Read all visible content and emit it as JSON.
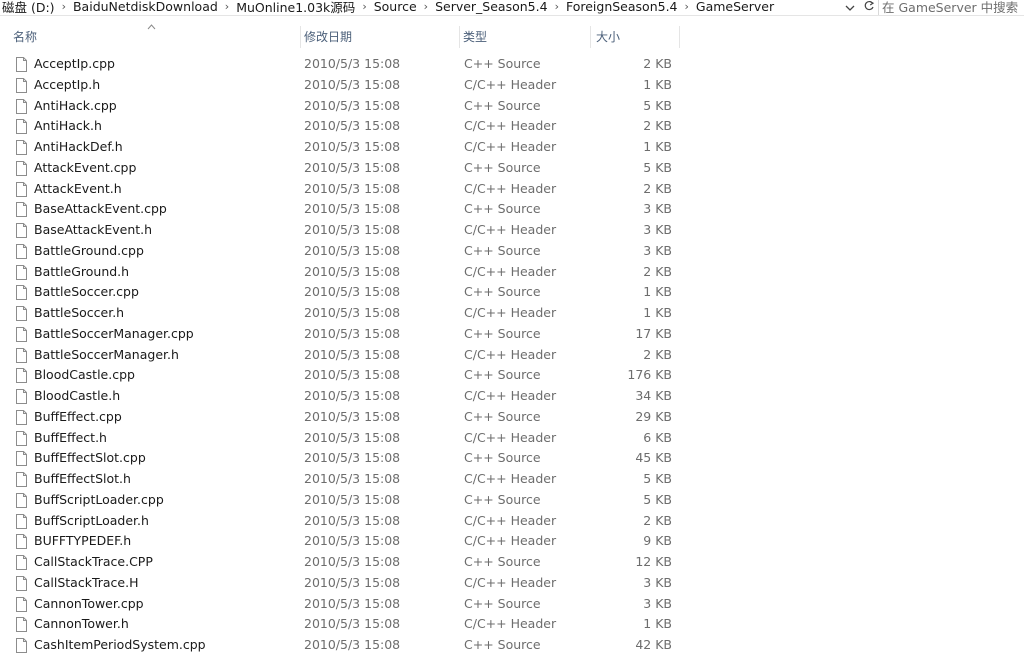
{
  "address": {
    "crumbs": [
      "磁盘 (D:)",
      "BaiduNetdiskDownload",
      "MuOnline1.03k源码",
      "Source",
      "Server_Season5.4",
      "ForeignSeason5.4",
      "GameServer"
    ],
    "search_placeholder": "在 GameServer 中搜索"
  },
  "columns": {
    "name": "名称",
    "date": "修改日期",
    "type": "类型",
    "size": "大小"
  },
  "files": [
    {
      "name": "AcceptIp.cpp",
      "date": "2010/5/3 15:08",
      "type": "C++ Source",
      "size": "2 KB"
    },
    {
      "name": "AcceptIp.h",
      "date": "2010/5/3 15:08",
      "type": "C/C++ Header",
      "size": "1 KB"
    },
    {
      "name": "AntiHack.cpp",
      "date": "2010/5/3 15:08",
      "type": "C++ Source",
      "size": "5 KB"
    },
    {
      "name": "AntiHack.h",
      "date": "2010/5/3 15:08",
      "type": "C/C++ Header",
      "size": "2 KB"
    },
    {
      "name": "AntiHackDef.h",
      "date": "2010/5/3 15:08",
      "type": "C/C++ Header",
      "size": "1 KB"
    },
    {
      "name": "AttackEvent.cpp",
      "date": "2010/5/3 15:08",
      "type": "C++ Source",
      "size": "5 KB"
    },
    {
      "name": "AttackEvent.h",
      "date": "2010/5/3 15:08",
      "type": "C/C++ Header",
      "size": "2 KB"
    },
    {
      "name": "BaseAttackEvent.cpp",
      "date": "2010/5/3 15:08",
      "type": "C++ Source",
      "size": "3 KB"
    },
    {
      "name": "BaseAttackEvent.h",
      "date": "2010/5/3 15:08",
      "type": "C/C++ Header",
      "size": "3 KB"
    },
    {
      "name": "BattleGround.cpp",
      "date": "2010/5/3 15:08",
      "type": "C++ Source",
      "size": "3 KB"
    },
    {
      "name": "BattleGround.h",
      "date": "2010/5/3 15:08",
      "type": "C/C++ Header",
      "size": "2 KB"
    },
    {
      "name": "BattleSoccer.cpp",
      "date": "2010/5/3 15:08",
      "type": "C++ Source",
      "size": "1 KB"
    },
    {
      "name": "BattleSoccer.h",
      "date": "2010/5/3 15:08",
      "type": "C/C++ Header",
      "size": "1 KB"
    },
    {
      "name": "BattleSoccerManager.cpp",
      "date": "2010/5/3 15:08",
      "type": "C++ Source",
      "size": "17 KB"
    },
    {
      "name": "BattleSoccerManager.h",
      "date": "2010/5/3 15:08",
      "type": "C/C++ Header",
      "size": "2 KB"
    },
    {
      "name": "BloodCastle.cpp",
      "date": "2010/5/3 15:08",
      "type": "C++ Source",
      "size": "176 KB"
    },
    {
      "name": "BloodCastle.h",
      "date": "2010/5/3 15:08",
      "type": "C/C++ Header",
      "size": "34 KB"
    },
    {
      "name": "BuffEffect.cpp",
      "date": "2010/5/3 15:08",
      "type": "C++ Source",
      "size": "29 KB"
    },
    {
      "name": "BuffEffect.h",
      "date": "2010/5/3 15:08",
      "type": "C/C++ Header",
      "size": "6 KB"
    },
    {
      "name": "BuffEffectSlot.cpp",
      "date": "2010/5/3 15:08",
      "type": "C++ Source",
      "size": "45 KB"
    },
    {
      "name": "BuffEffectSlot.h",
      "date": "2010/5/3 15:08",
      "type": "C/C++ Header",
      "size": "5 KB"
    },
    {
      "name": "BuffScriptLoader.cpp",
      "date": "2010/5/3 15:08",
      "type": "C++ Source",
      "size": "5 KB"
    },
    {
      "name": "BuffScriptLoader.h",
      "date": "2010/5/3 15:08",
      "type": "C/C++ Header",
      "size": "2 KB"
    },
    {
      "name": "BUFFTYPEDEF.h",
      "date": "2010/5/3 15:08",
      "type": "C/C++ Header",
      "size": "9 KB"
    },
    {
      "name": "CallStackTrace.CPP",
      "date": "2010/5/3 15:08",
      "type": "C++ Source",
      "size": "12 KB"
    },
    {
      "name": "CallStackTrace.H",
      "date": "2010/5/3 15:08",
      "type": "C/C++ Header",
      "size": "3 KB"
    },
    {
      "name": "CannonTower.cpp",
      "date": "2010/5/3 15:08",
      "type": "C++ Source",
      "size": "3 KB"
    },
    {
      "name": "CannonTower.h",
      "date": "2010/5/3 15:08",
      "type": "C/C++ Header",
      "size": "1 KB"
    },
    {
      "name": "CashItemPeriodSystem.cpp",
      "date": "2010/5/3 15:08",
      "type": "C++ Source",
      "size": "42 KB"
    }
  ]
}
